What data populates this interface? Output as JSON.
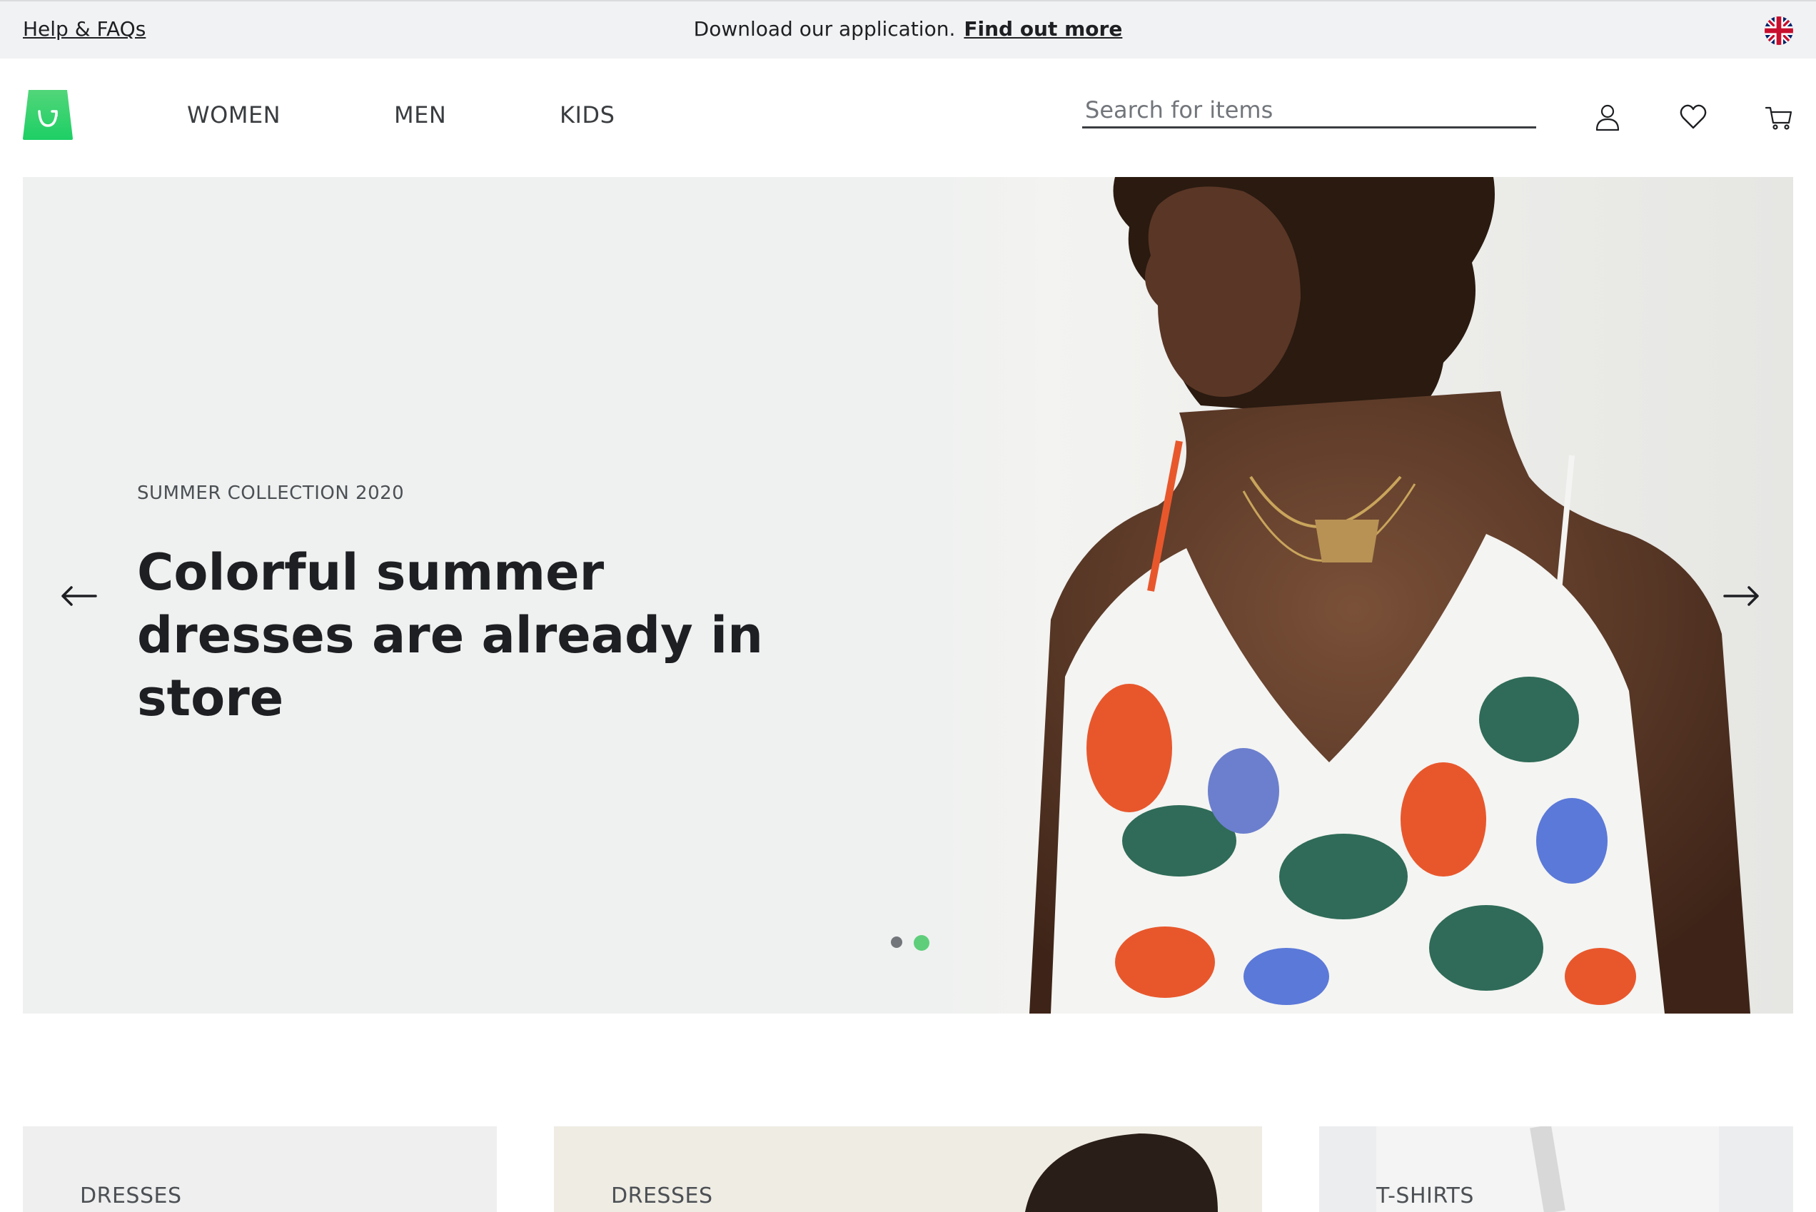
{
  "topbar": {
    "help_label": "Help & FAQs",
    "promo_text": "Download our application.",
    "promo_link": "Find out more",
    "language_icon": "uk-flag-icon"
  },
  "header": {
    "logo_icon": "shopping-bag-logo-icon",
    "nav": [
      "WOMEN",
      "MEN",
      "KIDS"
    ],
    "search": {
      "placeholder": "Search for items",
      "value": ""
    },
    "icons": [
      "account-icon",
      "wishlist-heart-icon",
      "cart-icon"
    ]
  },
  "hero": {
    "eyebrow": "SUMMER COLLECTION 2020",
    "title": "Colorful summer dresses are already in store",
    "prev_icon": "arrow-left-icon",
    "next_icon": "arrow-right-icon",
    "slides_total": 2,
    "active_slide": 2
  },
  "categories": [
    {
      "label": "DRESSES"
    },
    {
      "label": "DRESSES"
    },
    {
      "label": "T-SHIRTS"
    }
  ],
  "colors": {
    "accent": "#5ece7b",
    "text": "#1d1f22",
    "topbar_bg": "#f1f2f3",
    "hero_bg": "#eff1f0"
  }
}
